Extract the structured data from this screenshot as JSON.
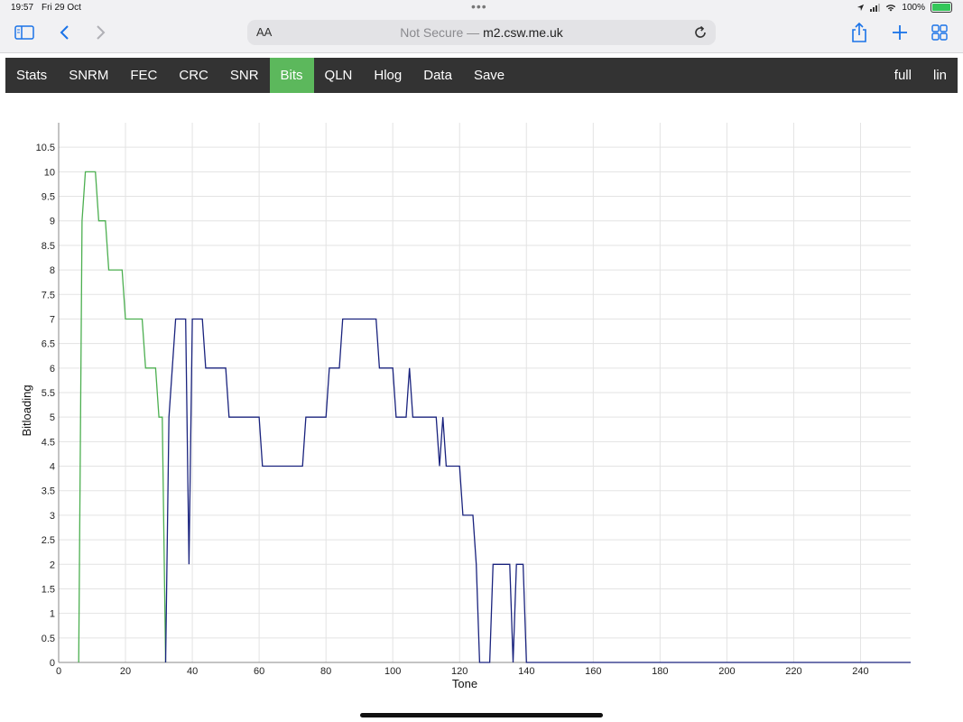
{
  "status_bar": {
    "time": "19:57",
    "date": "Fri 29 Oct",
    "battery": "100%"
  },
  "browser": {
    "text_size_label": "AA",
    "address_prefix": "Not Secure —",
    "address_host": "m2.csw.me.uk",
    "icons": [
      "sidebar-icon",
      "back-icon",
      "forward-icon",
      "reload-icon",
      "share-icon",
      "new-tab-icon",
      "tab-overview-icon"
    ]
  },
  "nav": {
    "items": [
      {
        "label": "Stats",
        "active": false
      },
      {
        "label": "SNRM",
        "active": false
      },
      {
        "label": "FEC",
        "active": false
      },
      {
        "label": "CRC",
        "active": false
      },
      {
        "label": "SNR",
        "active": false
      },
      {
        "label": "Bits",
        "active": true
      },
      {
        "label": "QLN",
        "active": false
      },
      {
        "label": "Hlog",
        "active": false
      },
      {
        "label": "Data",
        "active": false
      },
      {
        "label": "Save",
        "active": false
      }
    ],
    "right_items": [
      {
        "label": "full"
      },
      {
        "label": "lin"
      }
    ],
    "active_color": "#5cb85c",
    "bar_color": "#333333"
  },
  "chart_data": {
    "type": "line",
    "title": "",
    "xlabel": "Tone",
    "ylabel": "Bitloading",
    "xlim": [
      0,
      255
    ],
    "ylim": [
      0,
      11
    ],
    "x_ticks": [
      0,
      20,
      40,
      60,
      80,
      100,
      120,
      140,
      160,
      180,
      200,
      220,
      240
    ],
    "y_ticks": [
      0,
      0.5,
      1,
      1.5,
      2,
      2.5,
      3,
      3.5,
      4,
      4.5,
      5,
      5.5,
      6,
      6.5,
      7,
      7.5,
      8,
      8.5,
      9,
      9.5,
      10,
      10.5
    ],
    "grid": true,
    "series": [
      {
        "color": "#4caf50",
        "x": [
          6,
          7,
          8,
          11,
          12,
          14,
          15,
          19,
          20,
          25,
          26,
          29,
          30,
          31,
          32
        ],
        "y": [
          0,
          9,
          10,
          10,
          9,
          9,
          8,
          8,
          7,
          7,
          6,
          6,
          5,
          5,
          0
        ]
      },
      {
        "color": "#1a237e",
        "x": [
          32,
          33,
          34,
          35,
          38,
          39,
          40,
          43,
          44,
          50,
          51,
          60,
          61,
          73,
          74,
          80,
          81,
          84,
          85,
          95,
          96,
          100,
          101,
          104,
          105,
          106,
          113,
          114,
          115,
          116,
          120,
          121,
          124,
          125,
          126,
          129,
          130,
          135,
          136,
          137,
          139,
          140,
          255
        ],
        "y": [
          0,
          5,
          6,
          7,
          7,
          2,
          7,
          7,
          6,
          6,
          5,
          5,
          4,
          4,
          5,
          5,
          6,
          6,
          7,
          7,
          6,
          6,
          5,
          5,
          6,
          5,
          5,
          4,
          5,
          4,
          4,
          3,
          3,
          2,
          0,
          0,
          2,
          2,
          0,
          2,
          2,
          0,
          0
        ]
      }
    ]
  }
}
